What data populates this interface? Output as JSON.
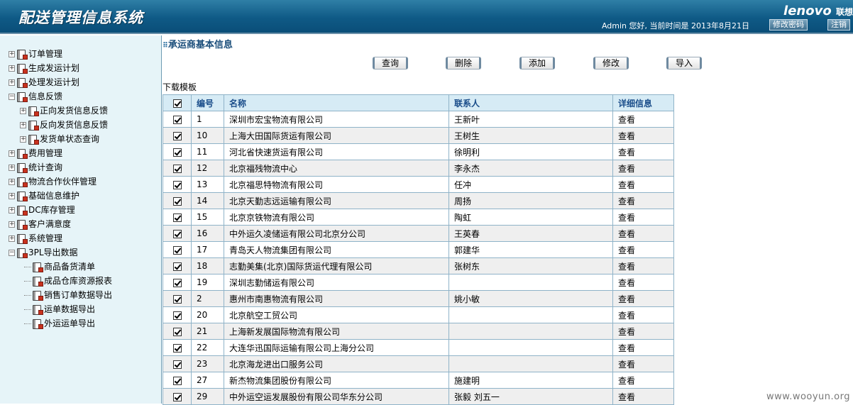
{
  "header": {
    "title": "配送管理信息系统",
    "logo_text": "lenovo",
    "logo_cn": "联想",
    "greeting": "Admin 您好, 当前时间是 2013年8月21日",
    "change_password_label": "修改密码",
    "logout_label": "注销"
  },
  "sidebar": {
    "items": [
      {
        "label": "订单管理"
      },
      {
        "label": "生成发运计划"
      },
      {
        "label": "处理发运计划"
      },
      {
        "label": "信息反馈"
      },
      {
        "label": "正向发货信息反馈"
      },
      {
        "label": "反向发货信息反馈"
      },
      {
        "label": "发货单状态查询"
      },
      {
        "label": "费用管理"
      },
      {
        "label": "统计查询"
      },
      {
        "label": "物流合作伙伴管理"
      },
      {
        "label": "基础信息维护"
      },
      {
        "label": "DC库存管理"
      },
      {
        "label": "客户满意度"
      },
      {
        "label": "系统管理"
      },
      {
        "label": "3PL导出数据"
      },
      {
        "label": "商品备货清单"
      },
      {
        "label": "成品仓库资源报表"
      },
      {
        "label": "销售订单数据导出"
      },
      {
        "label": "运单数据导出"
      },
      {
        "label": "外运运单导出"
      }
    ]
  },
  "main": {
    "section_title": "承运商基本信息",
    "toolbar": {
      "query": "查询",
      "delete": "删除",
      "add": "添加",
      "edit": "修改",
      "import": "导入"
    },
    "download_label": "下载模板",
    "table": {
      "columns": [
        "编号",
        "名称",
        "联系人",
        "详细信息"
      ],
      "rows": [
        {
          "id": "1",
          "name": "深圳市宏宝物流有限公司",
          "contact": "王新叶",
          "detail": "查看"
        },
        {
          "id": "10",
          "name": "上海大田国际货运有限公司",
          "contact": "王树生",
          "detail": "查看"
        },
        {
          "id": "11",
          "name": "河北省快速货运有限公司",
          "contact": "徐明利",
          "detail": "查看"
        },
        {
          "id": "12",
          "name": "北京福残物流中心",
          "contact": "李永杰",
          "detail": "查看"
        },
        {
          "id": "13",
          "name": "北京福思特物流有限公司",
          "contact": "任冲",
          "detail": "查看"
        },
        {
          "id": "14",
          "name": "北京天勤志远运输有限公司",
          "contact": "周扬",
          "detail": "查看"
        },
        {
          "id": "15",
          "name": "北京京铁物流有限公司",
          "contact": "陶虹",
          "detail": "查看"
        },
        {
          "id": "16",
          "name": "中外运久凌储运有限公司北京分公司",
          "contact": "王英春",
          "detail": "查看"
        },
        {
          "id": "17",
          "name": "青岛天人物流集团有限公司",
          "contact": "郭建华",
          "detail": "查看"
        },
        {
          "id": "18",
          "name": "志勤美集(北京)国际货运代理有限公司",
          "contact": "张树东",
          "detail": "查看"
        },
        {
          "id": "19",
          "name": "深圳志勤储运有限公司",
          "contact": "",
          "detail": "查看"
        },
        {
          "id": "2",
          "name": "惠州市南惠物流有限公司",
          "contact": "姚小敏",
          "detail": "查看"
        },
        {
          "id": "20",
          "name": "北京航空工贸公司",
          "contact": "",
          "detail": "查看"
        },
        {
          "id": "21",
          "name": "上海新发展国际物流有限公司",
          "contact": "",
          "detail": "查看"
        },
        {
          "id": "22",
          "name": "大连华迅国际运输有限公司上海分公司",
          "contact": "",
          "detail": "查看"
        },
        {
          "id": "23",
          "name": "北京海龙进出口服务公司",
          "contact": "",
          "detail": "查看"
        },
        {
          "id": "27",
          "name": "新杰物流集团股份有限公司",
          "contact": "施建明",
          "detail": "查看"
        },
        {
          "id": "29",
          "name": "中外运空运发展股份有限公司华东分公司",
          "contact": "张毅 刘五一",
          "detail": "查看"
        }
      ]
    }
  },
  "watermark": "www.wooyun.org"
}
